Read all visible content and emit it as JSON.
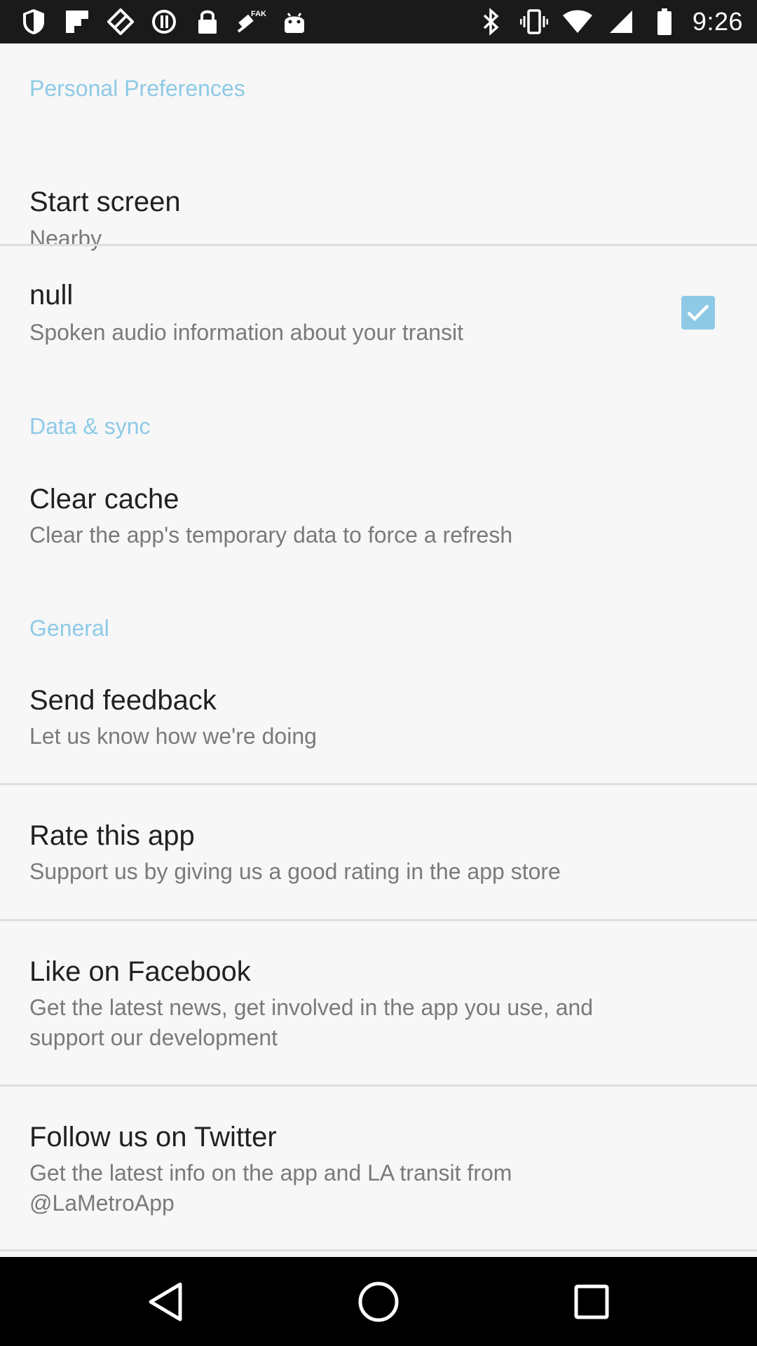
{
  "status_bar": {
    "time": "9:26",
    "left_icons": [
      "shield-icon",
      "flipboard-icon",
      "kite-icon",
      "sync-icon",
      "lock-icon",
      "fake-gps-icon",
      "android-icon"
    ],
    "right_icons": [
      "bluetooth-icon",
      "vibrate-icon",
      "wifi-icon",
      "signal-icon",
      "battery-icon"
    ]
  },
  "sections": {
    "personal": {
      "header": "Personal Preferences"
    },
    "data_sync": {
      "header": "Data & sync"
    },
    "general": {
      "header": "General"
    }
  },
  "prefs": {
    "start_screen": {
      "title": "Start screen",
      "summary": "Nearby"
    },
    "audio": {
      "title": "null",
      "summary": "Spoken audio information about your transit",
      "checked": true
    },
    "clear_cache": {
      "title": "Clear cache",
      "summary": "Clear the app's temporary data to force a refresh"
    },
    "send_feedback": {
      "title": "Send feedback",
      "summary": "Let us know how we're doing"
    },
    "rate_app": {
      "title": "Rate this app",
      "summary": "Support us by giving us a good rating in the app store"
    },
    "facebook": {
      "title": "Like on Facebook",
      "summary_line1": "Get the latest news, get involved in the app you use, and",
      "summary_line2": "support our development"
    },
    "twitter": {
      "title": "Follow us on Twitter",
      "summary_line1": "Get the latest info on the app and LA transit from",
      "summary_line2": "@LaMetroApp"
    }
  },
  "nav_bar": {
    "buttons": [
      "back-icon",
      "home-icon",
      "recents-icon"
    ]
  },
  "colors": {
    "accent": "#8ecae6",
    "status_bar": "#1a1a1a",
    "background": "#f7f7f8"
  }
}
